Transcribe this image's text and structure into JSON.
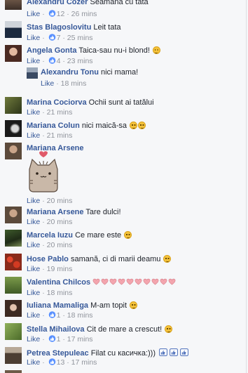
{
  "comments": [
    {
      "name": "Alexandru Cozer",
      "text": "Seamana cu tata",
      "like": "Like",
      "count": "12",
      "time": "26 mins"
    },
    {
      "name": "Stas Blagoslovitu",
      "text": "Leit tata",
      "like": "Like",
      "count": "7",
      "time": "25 mins"
    },
    {
      "name": "Angela Gonta",
      "text": "Taica-sau nu-i blond!",
      "like": "Like",
      "count": "4",
      "time": "23 mins"
    },
    {
      "name": "Alexandru Tonu",
      "text": "nici mama!",
      "like": "Like",
      "time": "18 mins"
    },
    {
      "name": "Marina Cociorva",
      "text": "Ochii sunt ai tatălui",
      "like": "Like",
      "time": "21 mins"
    },
    {
      "name": "Mariana Colun",
      "text": "nici maică-sa",
      "like": "Like",
      "time": "21 mins"
    },
    {
      "name": "Mariana Arsene",
      "text": "",
      "like": "Like",
      "time": "20 mins"
    },
    {
      "name": "Mariana Arsene",
      "text": "Tare dulci!",
      "like": "Like",
      "time": "20 mins"
    },
    {
      "name": "Marcela Iuzu",
      "text": "Ce mare este",
      "like": "Like",
      "time": "20 mins"
    },
    {
      "name": "Hose Pablo",
      "text": "samană, ci di marii deamu",
      "like": "Like",
      "time": "19 mins"
    },
    {
      "name": "Valentina Chilcos",
      "text": "",
      "like": "Like",
      "time": "18 mins"
    },
    {
      "name": "Iuliana Mamaliga",
      "text": "M-am topit",
      "like": "Like",
      "count": "1",
      "time": "18 mins"
    },
    {
      "name": "Stella Mihailova",
      "text": "Cit de mare a crescut!",
      "like": "Like",
      "count": "1",
      "time": "17 mins"
    },
    {
      "name": "Petrea Stepuleac",
      "text": "Filat cu касичка:)))",
      "like": "Like",
      "count": "13",
      "time": "17 mins"
    }
  ],
  "separator": "·",
  "colors": {
    "name": "#365899",
    "meta": "#90949c",
    "heart": "#f3a5ae",
    "like_blue": "#5890ff"
  }
}
